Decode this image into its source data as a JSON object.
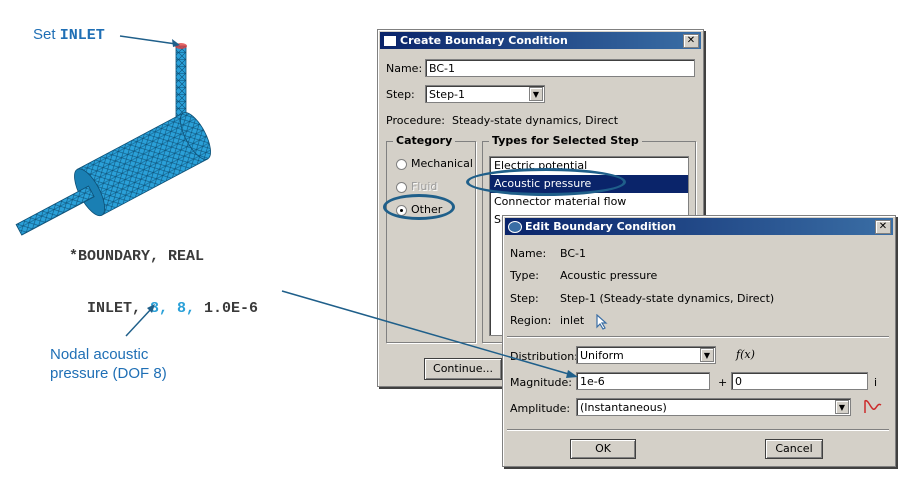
{
  "annotations": {
    "set_prefix": "Set ",
    "set_keyword": "INLET",
    "code_line1": "*BOUNDARY, REAL",
    "code_line2_a": "INLET, ",
    "code_line2_b": "8, 8,",
    "code_line2_c": " 1.0E-6",
    "nodal_line1": "Nodal acoustic",
    "nodal_line2": "pressure (DOF 8)"
  },
  "create_dialog": {
    "title": "Create Boundary Condition",
    "name_label": "Name:",
    "name_value": "BC-1",
    "step_label": "Step:",
    "step_value": "Step-1",
    "procedure_label": "Procedure:",
    "procedure_value": "Steady-state dynamics, Direct",
    "category_title": "Category",
    "categories": [
      "Mechanical",
      "Fluid",
      "Other"
    ],
    "types_title": "Types for Selected Step",
    "types": [
      "Electric potential",
      "Acoustic pressure",
      "Connector material flow",
      "Su"
    ],
    "continue_label": "Continue..."
  },
  "edit_dialog": {
    "title": "Edit Boundary Condition",
    "name_label": "Name:",
    "name_value": "BC-1",
    "type_label": "Type:",
    "type_value": "Acoustic pressure",
    "step_label": "Step:",
    "step_value": "Step-1 (Steady-state dynamics, Direct)",
    "region_label": "Region:",
    "region_value": "inlet",
    "distribution_label": "Distribution:",
    "distribution_value": "Uniform",
    "fx_label": "f(x)",
    "magnitude_label": "Magnitude:",
    "magnitude_real": "1e-6",
    "plus": "+",
    "magnitude_imag": "0",
    "imag_unit": "i",
    "amplitude_label": "Amplitude:",
    "amplitude_value": "(Instantaneous)",
    "ok_label": "OK",
    "cancel_label": "Cancel"
  },
  "colors": {
    "mesh": "#2aa0d8",
    "annotation": "#1f6fb5",
    "highlight_ellipse": "#1f5f8a",
    "titlebar": "#0a246a"
  }
}
